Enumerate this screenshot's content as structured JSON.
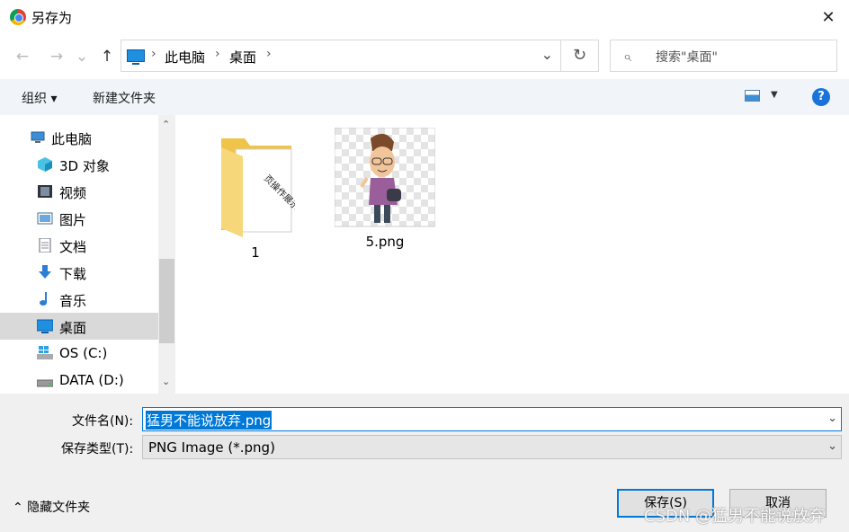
{
  "window": {
    "title": "另存为",
    "close": "✕"
  },
  "nav": {
    "back": "←",
    "forward": "→",
    "recent": "⌄",
    "up": "↑",
    "breadcrumb": [
      "此电脑",
      "桌面"
    ],
    "sep": "›",
    "dropdown": "⌄",
    "refresh": "↻",
    "search_placeholder": "搜索\"桌面\""
  },
  "commands": {
    "organize": "组织 ▾",
    "new_folder": "新建文件夹",
    "help": "?"
  },
  "sidebar": {
    "items": [
      {
        "label": "此电脑",
        "icon": "computer-icon"
      },
      {
        "label": "3D 对象",
        "icon": "cube-3d-icon"
      },
      {
        "label": "视频",
        "icon": "film-icon"
      },
      {
        "label": "图片",
        "icon": "picture-icon"
      },
      {
        "label": "文档",
        "icon": "document-icon"
      },
      {
        "label": "下载",
        "icon": "download-arrow-icon"
      },
      {
        "label": "音乐",
        "icon": "music-note-icon"
      },
      {
        "label": "桌面",
        "icon": "desktop-icon",
        "selected": true
      },
      {
        "label": "OS (C:)",
        "icon": "windows-drive-icon"
      },
      {
        "label": "DATA (D:)",
        "icon": "drive-icon"
      }
    ],
    "scroll_up": "⌃",
    "scroll_down": "⌄"
  },
  "files": [
    {
      "name": "1",
      "type": "folder",
      "folder_text": "页操作展示"
    },
    {
      "name": "5.png",
      "type": "image"
    }
  ],
  "form": {
    "filename_label": "文件名(N):",
    "filename_value": "猛男不能说放弃.png",
    "filetype_label": "保存类型(T):",
    "filetype_value": "PNG Image (*.png)",
    "dropdown": "⌄"
  },
  "footer": {
    "hide_folders": "⌃  隐藏文件夹",
    "save": "保存(S)",
    "cancel": "取消"
  },
  "watermark": "CSDN @猛男不能说放弃"
}
